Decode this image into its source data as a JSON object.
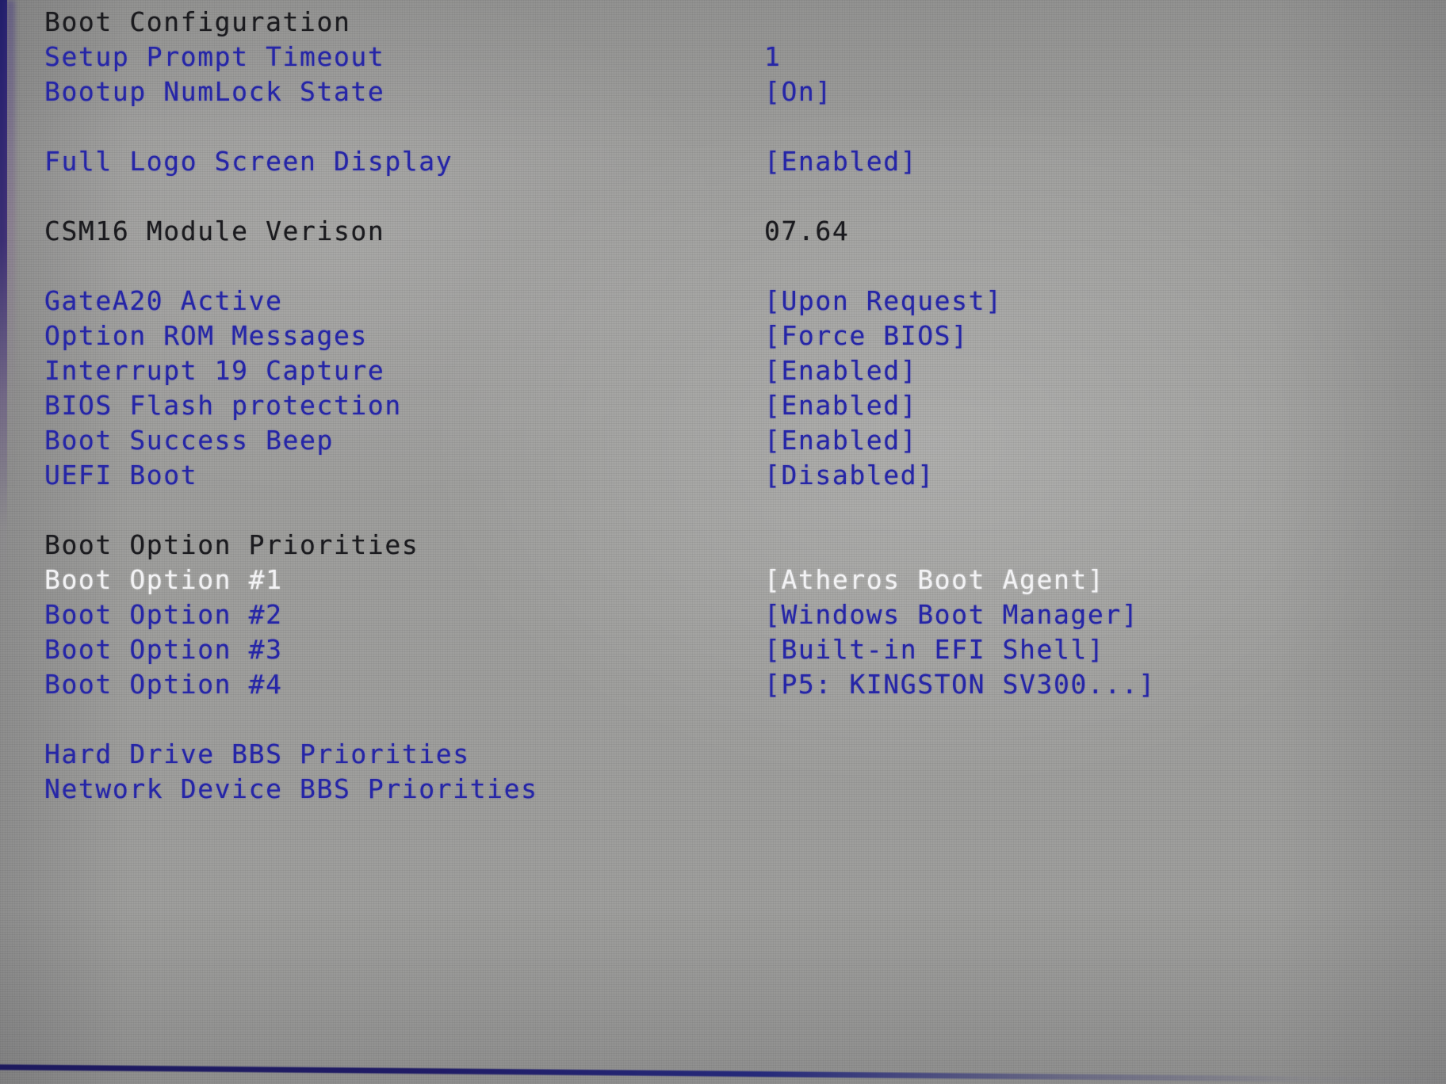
{
  "screen": {
    "kind": "bios-setup",
    "section": "Boot",
    "background_color": "#9c9c9a",
    "colors": {
      "normal_text": "#2626a6",
      "header_text": "#1b1b1f",
      "selected_text": "#f2f2f4",
      "edge_line": "#201c66"
    }
  },
  "rows": [
    {
      "label": "Boot Configuration",
      "value": "",
      "label_style": "dark",
      "value_style": "dark"
    },
    {
      "label": "Setup Prompt Timeout",
      "value": "1",
      "label_style": "blue",
      "value_style": "blue"
    },
    {
      "label": "Bootup NumLock State",
      "value": "[On]",
      "label_style": "blue",
      "value_style": "blue"
    },
    {
      "label": "",
      "value": "",
      "label_style": "blue",
      "value_style": "blue"
    },
    {
      "label": "Full Logo Screen Display",
      "value": "[Enabled]",
      "label_style": "blue",
      "value_style": "blue"
    },
    {
      "label": "",
      "value": "",
      "label_style": "blue",
      "value_style": "blue"
    },
    {
      "label": "CSM16 Module Verison",
      "value": "07.64",
      "label_style": "dark",
      "value_style": "dark"
    },
    {
      "label": "",
      "value": "",
      "label_style": "blue",
      "value_style": "blue"
    },
    {
      "label": "GateA20 Active",
      "value": "[Upon Request]",
      "label_style": "blue",
      "value_style": "blue"
    },
    {
      "label": "Option ROM Messages",
      "value": "[Force BIOS]",
      "label_style": "blue",
      "value_style": "blue"
    },
    {
      "label": "Interrupt 19 Capture",
      "value": "[Enabled]",
      "label_style": "blue",
      "value_style": "blue"
    },
    {
      "label": "BIOS Flash protection",
      "value": "[Enabled]",
      "label_style": "blue",
      "value_style": "blue"
    },
    {
      "label": "Boot Success Beep",
      "value": "[Enabled]",
      "label_style": "blue",
      "value_style": "blue"
    },
    {
      "label": "UEFI Boot",
      "value": "[Disabled]",
      "label_style": "blue",
      "value_style": "blue"
    },
    {
      "label": "",
      "value": "",
      "label_style": "blue",
      "value_style": "blue"
    },
    {
      "label": "Boot Option Priorities",
      "value": "",
      "label_style": "dark",
      "value_style": "dark"
    },
    {
      "label": "Boot Option #1",
      "value": "[Atheros Boot Agent]",
      "label_style": "white",
      "value_style": "white"
    },
    {
      "label": "Boot Option #2",
      "value": "[Windows Boot Manager]",
      "label_style": "blue",
      "value_style": "blue"
    },
    {
      "label": "Boot Option #3",
      "value": "[Built-in EFI Shell]",
      "label_style": "blue",
      "value_style": "blue"
    },
    {
      "label": "Boot Option #4",
      "value": "[P5: KINGSTON SV300...]",
      "label_style": "blue",
      "value_style": "blue"
    },
    {
      "label": "",
      "value": "",
      "label_style": "blue",
      "value_style": "blue"
    },
    {
      "label": "Hard Drive BBS Priorities",
      "value": "",
      "label_style": "blue",
      "value_style": "blue"
    },
    {
      "label": "Network Device BBS Priorities",
      "value": "",
      "label_style": "blue",
      "value_style": "blue"
    }
  ]
}
